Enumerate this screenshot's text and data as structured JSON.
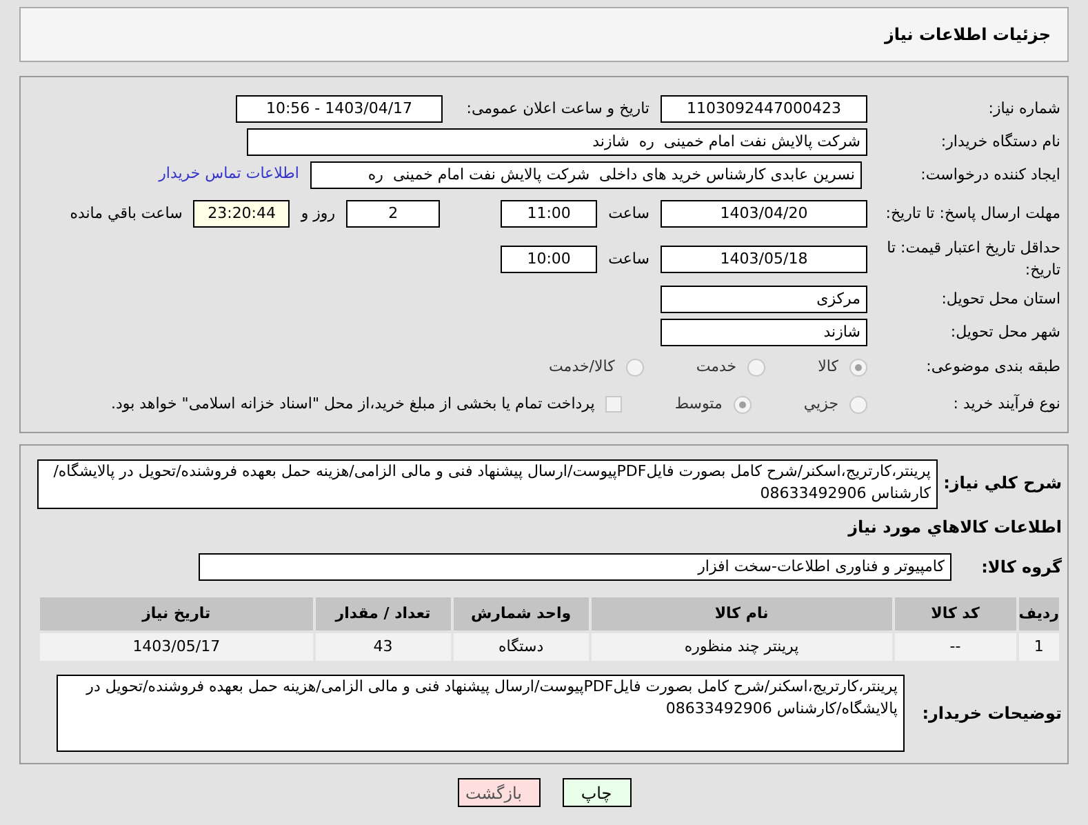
{
  "header": {
    "title": "جزئیات اطلاعات نیاز"
  },
  "details": {
    "need_number": {
      "label": "شماره نیاز:",
      "value": "1103092447000423"
    },
    "announce": {
      "label": "تاریخ و ساعت اعلان عمومی:",
      "value": "1403/04/17 - 10:56"
    },
    "buyer": {
      "label": "نام دستگاه خریدار:",
      "value": "شرکت پالایش نفت امام خمینی  ره  شازند"
    },
    "creator": {
      "label": "ایجاد کننده درخواست:",
      "value": "نسرین عابدی کارشناس خرید های داخلی  شرکت پالایش نفت امام خمینی  ره",
      "link": "اطلاعات تماس خریدار"
    },
    "deadline": {
      "label": "مهلت ارسال پاسخ: تا تاریخ:",
      "date": "1403/04/20",
      "time_label": "ساعت",
      "time": "11:00",
      "days": "2",
      "days_label": "روز و",
      "remaining": "23:20:44",
      "remaining_label": "ساعت باقي مانده"
    },
    "validity": {
      "label": "حداقل تاریخ اعتبار قیمت: تا تاریخ:",
      "date": "1403/05/18",
      "time_label": "ساعت",
      "time": "10:00"
    },
    "province": {
      "label": "استان محل تحویل:",
      "value": "مرکزی"
    },
    "city": {
      "label": "شهر محل تحویل:",
      "value": "شازند"
    },
    "category": {
      "label": "طبقه بندی موضوعی:",
      "options": [
        {
          "label": "كالا",
          "selected": true
        },
        {
          "label": "خدمت",
          "selected": false
        },
        {
          "label": "كالا/خدمت",
          "selected": false
        }
      ]
    },
    "process": {
      "label": "نوع فرآیند خرید :",
      "options": [
        {
          "label": "جزيي",
          "selected": false
        },
        {
          "label": "متوسط",
          "selected": true
        }
      ],
      "treasury": {
        "label": "پرداخت تمام یا بخشی از مبلغ خرید،از محل \"اسناد خزانه اسلامی\" خواهد بود.",
        "checked": false
      }
    }
  },
  "need": {
    "description_label": "شرح کلي نیاز:",
    "description": "پرینتر،کارتریج،اسکنر/شرح کامل بصورت فایلPDFپیوست/ارسال پیشنهاد فنی و مالی الزامی/هزینه حمل بعهده فروشنده/تحویل در پالایشگاه/کارشناس 08633492906",
    "goods_title": "اطلاعات کالاهاي مورد نیاز",
    "group_label": "گروه کالا:",
    "group": "کامپیوتر و فناوری اطلاعات-سخت افزار"
  },
  "table": {
    "columns": [
      "ردیف",
      "کد کالا",
      "نام کالا",
      "واحد شمارش",
      "تعداد / مقدار",
      "تاریخ نیاز"
    ],
    "rows": [
      [
        "1",
        "--",
        "پرینتر چند منظوره",
        "دستگاه",
        "43",
        "1403/05/17"
      ]
    ]
  },
  "buyer_notes": {
    "label": "توضیحات خریدار:",
    "value": "پرینتر،کارتریج،اسکنر/شرح کامل بصورت فایلPDFپیوست/ارسال پیشنهاد فنی و مالی الزامی/هزینه حمل بعهده فروشنده/تحویل در پالایشگاه/کارشناس 08633492906"
  },
  "buttons": [
    {
      "label": "چاپ",
      "kind": "print"
    },
    {
      "label": "بازگشت",
      "kind": "back"
    }
  ]
}
